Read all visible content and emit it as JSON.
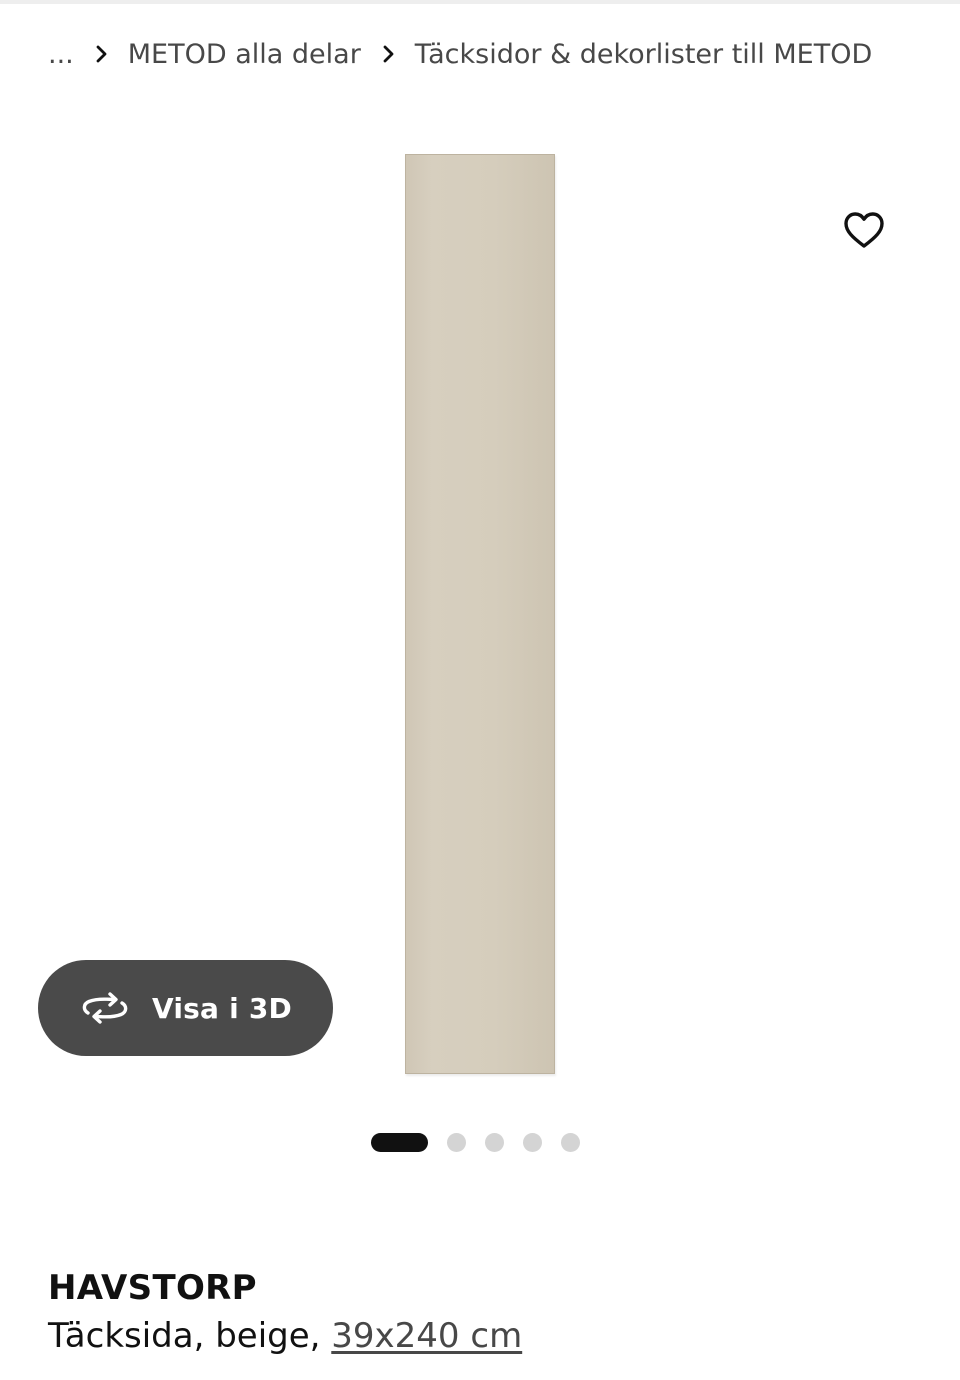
{
  "breadcrumb": {
    "ellipsis": "...",
    "items": [
      {
        "label": "METOD alla delar"
      },
      {
        "label": "Täcksidor & dekorlister till METOD"
      }
    ]
  },
  "gallery": {
    "panel_color": "#d4ccbb",
    "view_3d_label": "Visa i 3D",
    "favorite_icon": "heart-outline-icon",
    "rotate_icon": "rotate-3d-icon",
    "slide_count": 5,
    "active_slide": 1
  },
  "product": {
    "name": "HAVSTORP",
    "description": "Täcksida, beige,",
    "size": "39x240 cm"
  }
}
